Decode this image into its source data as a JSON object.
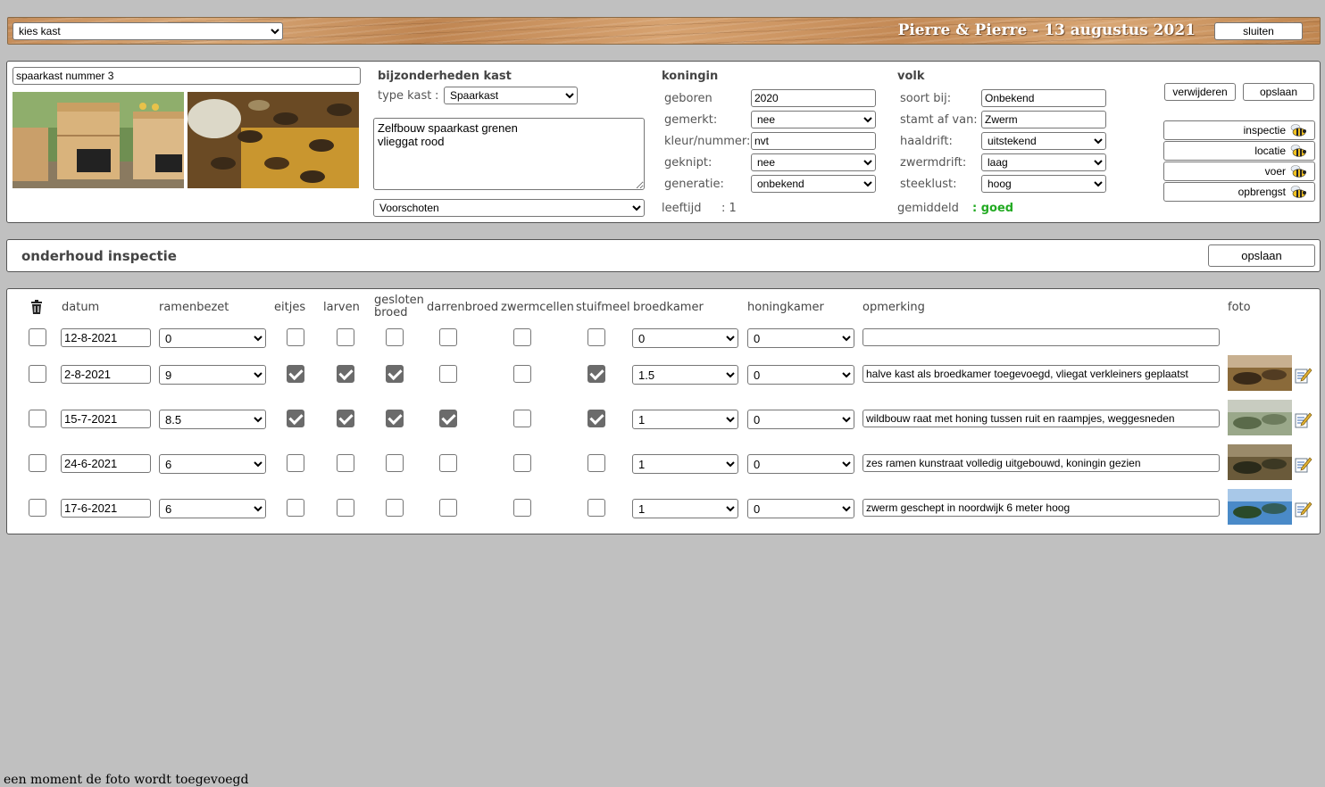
{
  "header": {
    "hive_select": "kies kast",
    "title": "Pierre & Pierre - 13 augustus 2021",
    "close_label": "sluiten"
  },
  "hive": {
    "name": "spaarkast nummer 3",
    "details_title": "bijzonderheden kast",
    "type_label": "type kast",
    "type_value": "Spaarkast",
    "description": "Zelfbouw spaarkast grenen\nvlieggat rood",
    "location": "Voorschoten"
  },
  "queen": {
    "title": "koningin",
    "born_label": "geboren",
    "born_value": "2020",
    "marked_label": "gemerkt:",
    "marked_value": "nee",
    "color_label": "kleur/nummer:",
    "color_value": "nvt",
    "clipped_label": "geknipt:",
    "clipped_value": "nee",
    "generation_label": "generatie:",
    "generation_value": "onbekend",
    "age_label": "leeftijd",
    "age_value": ": 1"
  },
  "colony": {
    "title": "volk",
    "species_label": "soort bij:",
    "species_value": "Onbekend",
    "origin_label": "stamt af van:",
    "origin_value": "Zwerm",
    "forage_label": "haaldrift:",
    "forage_value": "uitstekend",
    "swarm_label": "zwermdrift:",
    "swarm_value": "laag",
    "sting_label": "steeklust:",
    "sting_value": "hoog",
    "average_label": "gemiddeld",
    "average_value": ": goed",
    "average_color": "#22aa22"
  },
  "actions": {
    "delete_label": "verwijderen",
    "save_label": "opslaan",
    "nav": [
      "inspectie",
      "locatie",
      "voer",
      "opbrengst"
    ]
  },
  "maintenance": {
    "title": "onderhoud inspectie",
    "save_label": "opslaan"
  },
  "table": {
    "headers": {
      "datum": "datum",
      "ramenbezet": "ramenbezet",
      "eitjes": "eitjes",
      "larven": "larven",
      "gesloten_broed_1": "gesloten",
      "gesloten_broed_2": "broed",
      "darrenbroed": "darrenbroed",
      "zwermcellen": "zwermcellen",
      "stuifmeel": "stuifmeel",
      "broedkamer": "broedkamer",
      "honingkamer": "honingkamer",
      "opmerking": "opmerking",
      "foto": "foto"
    },
    "rows": [
      {
        "date": "12-8-2021",
        "frames": "0",
        "eggs": false,
        "larvae": false,
        "capped": false,
        "drone": false,
        "swarmcells": false,
        "pollen": false,
        "brood": "0",
        "honey": "0",
        "note": "",
        "photo": false
      },
      {
        "date": "2-8-2021",
        "frames": "9",
        "eggs": true,
        "larvae": true,
        "capped": true,
        "drone": false,
        "swarmcells": false,
        "pollen": true,
        "brood": "1.5",
        "honey": "0",
        "note": "halve kast als broedkamer toegevoegd, vliegat verkleiners geplaatst",
        "photo": true
      },
      {
        "date": "15-7-2021",
        "frames": "8.5",
        "eggs": true,
        "larvae": true,
        "capped": true,
        "drone": true,
        "swarmcells": false,
        "pollen": true,
        "brood": "1",
        "honey": "0",
        "note": "wildbouw raat met honing tussen ruit en raampjes, weggesneden",
        "photo": true
      },
      {
        "date": "24-6-2021",
        "frames": "6",
        "eggs": false,
        "larvae": false,
        "capped": false,
        "drone": false,
        "swarmcells": false,
        "pollen": false,
        "brood": "1",
        "honey": "0",
        "note": "zes ramen kunstraat volledig uitgebouwd, koningin gezien",
        "photo": true
      },
      {
        "date": "17-6-2021",
        "frames": "6",
        "eggs": false,
        "larvae": false,
        "capped": false,
        "drone": false,
        "swarmcells": false,
        "pollen": false,
        "brood": "1",
        "honey": "0",
        "note": "zwerm geschept in noordwijk 6 meter hoog",
        "photo": true
      }
    ]
  },
  "footer_message": "een moment de foto wordt toegevoegd"
}
